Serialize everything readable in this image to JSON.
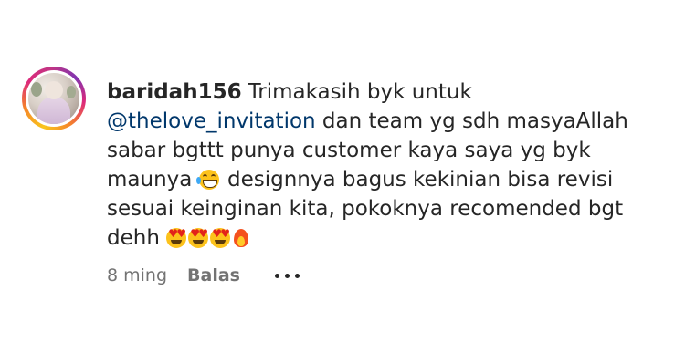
{
  "comment": {
    "username": "baridah156",
    "text_before_mention": "Trimakasih byk untuk",
    "mention": "@thelove_invitation",
    "text_part2": "dan team yg sdh masyaAllah sabar bgttt punya customer kaya saya yg byk maunya",
    "text_part3": "designnya bagus kekinian bisa revisi sesuai keinginan kita, pokoknya recomended bgt dehh",
    "emojis_mid": [
      "face-with-tears-of-joy"
    ],
    "emojis_end": [
      "heart-eyes",
      "heart-eyes",
      "heart-eyes",
      "fire"
    ],
    "timestamp": "8 ming",
    "reply_label": "Balas",
    "more_icon": "more-options-icon"
  },
  "colors": {
    "text": "#262626",
    "mention": "#00376b",
    "meta": "#737373",
    "story_ring": [
      "#f9c61d",
      "#f58529",
      "#dd2a7b",
      "#c13584",
      "#8134af"
    ]
  }
}
